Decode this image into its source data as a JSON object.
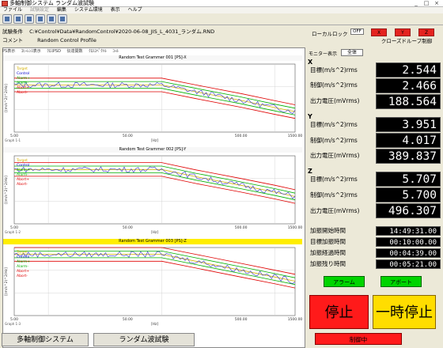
{
  "window": {
    "title": "多軸制御システム ランダム波試験"
  },
  "menu": [
    "ファイル",
    "試験設定",
    "編集",
    "システム環境",
    "表示",
    "ヘルプ"
  ],
  "toolbar": [
    "open-icon",
    "save-icon",
    "print-icon",
    "settings-icon",
    "graph-icon",
    "help-icon"
  ],
  "test": {
    "condition_label": "試験条件",
    "condition_value": "C:¥Control¥Data¥RandomControl¥2020-06-08_JIS_L_4031_ランダム.RND",
    "comment_label": "コメント",
    "comment_value": "Random Control Profile"
  },
  "local_lock": {
    "label": "ローカルロック",
    "value": "OFF"
  },
  "axes_buttons": [
    "X",
    "Y",
    "Z"
  ],
  "closed_loop": "クローズドループ制御",
  "chart_tabs": [
    "PS表示",
    "ｺﾋｰﾚﾝｽ表示",
    "ｸﾛｽPSD",
    "伝達関数",
    "ｸﾛｽｽﾍﾟｸﾄﾙ",
    "ｺｰﾙ"
  ],
  "monitor": {
    "label": "モニター表示",
    "value": "全体"
  },
  "readouts": [
    {
      "axis": "X",
      "target_label": "目標(m/s^2)rms",
      "target": "2.544",
      "control_label": "制御(m/s^2)rms",
      "control": "2.466",
      "output_label": "出力電圧(mVrms)",
      "output": "188.564"
    },
    {
      "axis": "Y",
      "target_label": "目標(m/s^2)rms",
      "target": "3.951",
      "control_label": "制御(m/s^2)rms",
      "control": "4.017",
      "output_label": "出力電圧(mVrms)",
      "output": "389.837"
    },
    {
      "axis": "Z",
      "target_label": "目標(m/s^2)rms",
      "target": "5.707",
      "control_label": "制御(m/s^2)rms",
      "control": "5.700",
      "output_label": "出力電圧(mVrms)",
      "output": "496.307"
    }
  ],
  "times": [
    {
      "label": "加振開始時間",
      "value": "14:49:31.00"
    },
    {
      "label": "目標加振時間",
      "value": "00:10:00.00"
    },
    {
      "label": "加振経過時間",
      "value": "00:04:39.00"
    },
    {
      "label": "加振残り時間",
      "value": "00:05:21.00"
    }
  ],
  "buttons": {
    "alarm": "アラーム",
    "abort": "アボート",
    "stop": "停止",
    "pause": "一時停止"
  },
  "status": {
    "system": "多軸制御システム",
    "test_type": "ランダム波試験",
    "run_state": "制御中"
  },
  "colors": {
    "stop": "#ff1a1a",
    "pause": "#ffdd00",
    "go": "#00d400",
    "axis_active": "#e4231f"
  },
  "chart_data": [
    {
      "type": "line",
      "title": "Random Test Grammer 001 [PS]-X",
      "legend": [
        "Target",
        "Control",
        "Alarm+",
        "Alarm-",
        "Abort+",
        "Abort-"
      ],
      "xlabel": "[Hz]",
      "ylabel": "[(m/s^2)^2/Hz]",
      "x_ticks": [
        "5.00",
        "50.00",
        "500.00",
        "1500.00"
      ],
      "footer": "Graph 1-1",
      "x": [
        5,
        10,
        20,
        50,
        100,
        200,
        500,
        1000,
        1500
      ],
      "target": [
        0.012,
        0.012,
        0.012,
        0.012,
        0.012,
        0.006,
        0.0025,
        0.0012,
        0.0008
      ],
      "xlim": [
        5,
        1500
      ],
      "ylim": [
        0.0001,
        0.1
      ],
      "log": true
    },
    {
      "type": "line",
      "title": "Random Test Grammer 002 [PS]-Y",
      "legend": [
        "Target",
        "Control",
        "Alarm+",
        "Alarm-",
        "Abort+",
        "Abort-"
      ],
      "xlabel": "[Hz]",
      "ylabel": "[(m/s^2)^2/Hz]",
      "x_ticks": [
        "5.00",
        "50.00",
        "500.00",
        "1500.00"
      ],
      "footer": "Graph 1-2",
      "x": [
        5,
        10,
        20,
        50,
        100,
        200,
        500,
        1000,
        1500
      ],
      "target": [
        0.025,
        0.025,
        0.025,
        0.025,
        0.025,
        0.012,
        0.005,
        0.0025,
        0.0016
      ],
      "xlim": [
        5,
        1500
      ],
      "ylim": [
        0.0001,
        0.1
      ],
      "log": true
    },
    {
      "type": "line",
      "title": "Random Test Grammer 003 [PS]-Z",
      "legend": [
        "Target",
        "Control",
        "Alarm+",
        "Alarm-",
        "Abort+",
        "Abort-"
      ],
      "xlabel": "[Hz]",
      "ylabel": "[(m/s^2)^2/Hz]",
      "x_ticks": [
        "5.00",
        "50.00",
        "500.00",
        "1500.00"
      ],
      "footer": "Graph 1-3",
      "x": [
        5,
        10,
        20,
        50,
        100,
        200,
        500,
        1000,
        1500
      ],
      "target": [
        0.05,
        0.05,
        0.05,
        0.05,
        0.05,
        0.025,
        0.01,
        0.005,
        0.0033
      ],
      "xlim": [
        5,
        1500
      ],
      "ylim": [
        0.0001,
        0.1
      ],
      "log": true
    }
  ]
}
